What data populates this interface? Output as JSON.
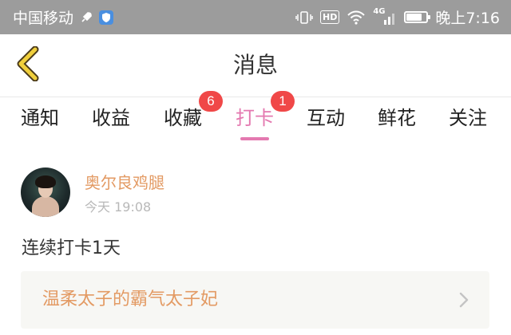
{
  "status_bar": {
    "carrier": "中国移动",
    "hd_label": "HD",
    "network_label": "4G",
    "time": "晚上7:16",
    "battery_level": 0.78,
    "icons": [
      "rocket-icon",
      "shield-icon",
      "vibrate-icon",
      "hd-icon",
      "wifi-icon",
      "signal-icon",
      "battery-icon"
    ]
  },
  "header": {
    "title": "消息",
    "back_icon": "chevron-left-icon"
  },
  "tabs": [
    {
      "label": "通知",
      "badge": ""
    },
    {
      "label": "收益",
      "badge": ""
    },
    {
      "label": "收藏",
      "badge": "6"
    },
    {
      "label": "打卡",
      "badge": "1",
      "active": true
    },
    {
      "label": "互动",
      "badge": ""
    },
    {
      "label": "鲜花",
      "badge": ""
    },
    {
      "label": "关注",
      "badge": ""
    }
  ],
  "message": {
    "username": "奥尔良鸡腿",
    "timestamp": "今天 19:08",
    "text": "连续打卡1天",
    "link_title": "温柔太子的霸气太子妃"
  },
  "colors": {
    "status_bar_bg": "#9c9c9c",
    "accent_pink": "#e479b0",
    "badge_red": "#f04848",
    "name_orange": "#e39a63",
    "back_icon_yellow": "#f0cf3c"
  }
}
